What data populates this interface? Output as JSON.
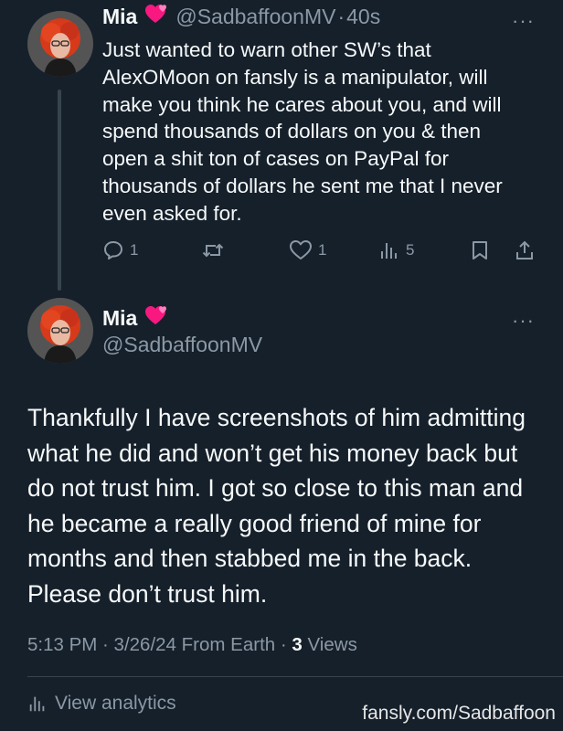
{
  "colors": {
    "background": "#15202b",
    "text": "#f7f9f9",
    "muted": "#8b98a5",
    "heart": "#f91880"
  },
  "tweet1": {
    "name": "Mia",
    "name_emoji": "heart-emoji",
    "handle": "@SadbaffoonMV",
    "sep": "·",
    "time": "40s",
    "more": "···",
    "text": "Just wanted to warn other SW’s that AlexOMoon on fansly is a manipulator, will make you think he cares about you, and will spend thousands of dollars on you & then open a shit ton of cases on PayPal for thousands of dollars he sent me that I never even asked for.",
    "actions": {
      "reply_count": "1",
      "retweet_count": "",
      "like_count": "1",
      "views_count": "5"
    }
  },
  "tweet2": {
    "name": "Mia",
    "handle": "@SadbaffoonMV",
    "more": "···",
    "text": "Thankfully I have screenshots of him admitting what he did and won’t get his money back but do not trust him. I got so close to this man and he became a really good friend of mine for months and then stabbed me in the back. Please don’t trust him.",
    "meta": {
      "time_date": "5:13 PM · 3/26/24 From Earth · ",
      "views_count": "3",
      "views_label": " Views"
    },
    "analytics_label": "View analytics"
  },
  "watermark": "fansly.com/Sadbaffoon"
}
